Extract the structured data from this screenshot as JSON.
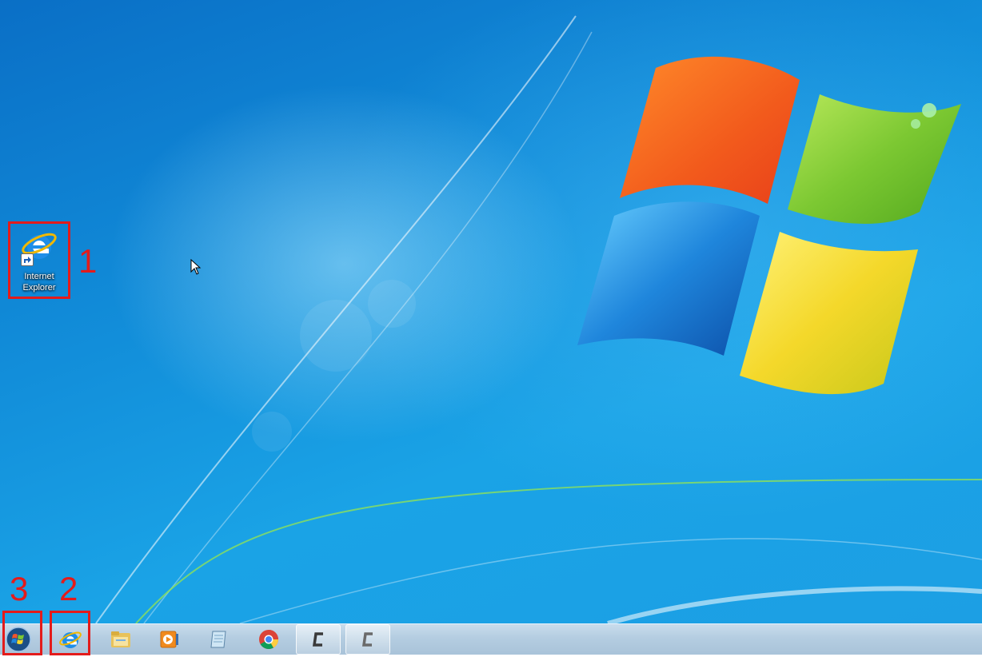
{
  "desktop": {
    "icons": [
      {
        "label": "Internet\nExplorer",
        "icon": "internet-explorer-icon"
      }
    ]
  },
  "annotations": {
    "marker_1": "1",
    "marker_2": "2",
    "marker_3": "3",
    "color": "#e31b1b"
  },
  "taskbar": {
    "start_icon": "windows-start-orb-icon",
    "pinned": [
      {
        "name": "internet-explorer",
        "icon": "internet-explorer-icon"
      },
      {
        "name": "file-explorer",
        "icon": "folder-icon"
      },
      {
        "name": "media-player",
        "icon": "media-player-icon"
      },
      {
        "name": "notepad",
        "icon": "notepad-icon"
      },
      {
        "name": "chrome",
        "icon": "chrome-icon"
      },
      {
        "name": "app-c-1",
        "icon": "c-app-icon"
      },
      {
        "name": "app-c-2",
        "icon": "c-app-icon"
      }
    ]
  }
}
